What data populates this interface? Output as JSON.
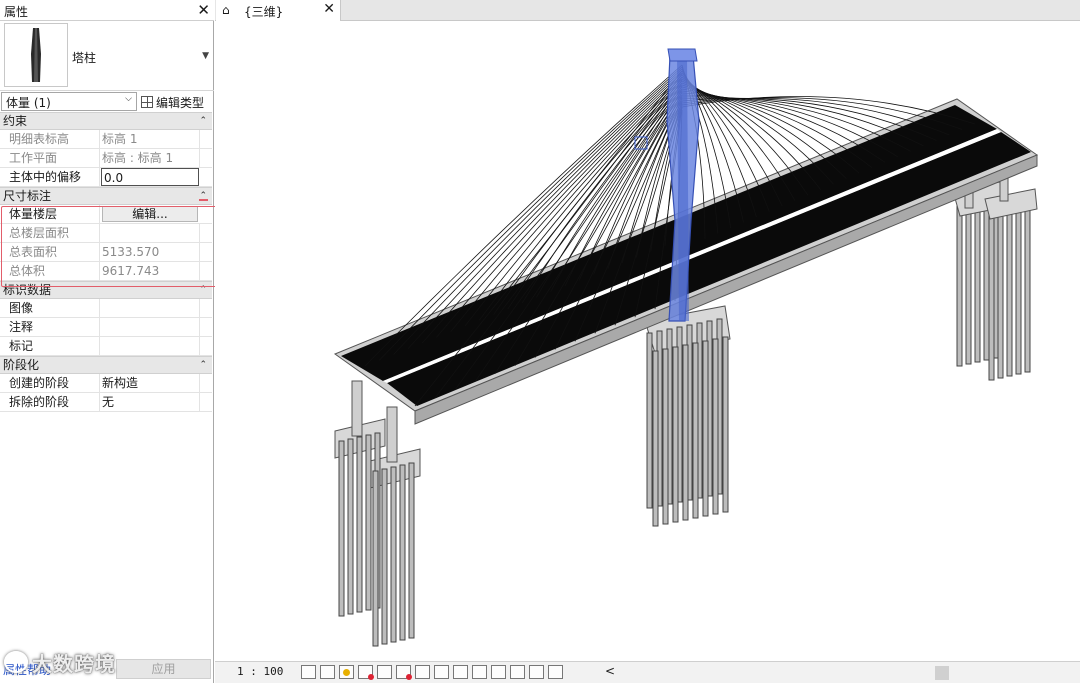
{
  "properties": {
    "title": "属性",
    "type_name": "塔柱",
    "instance_select": "体量 (1)",
    "edit_type_label": "编辑类型",
    "sections": [
      {
        "name": "约束",
        "rows": [
          {
            "key": "明细表标高",
            "value": "标高 1",
            "disabled": true
          },
          {
            "key": "工作平面",
            "value": "标高 : 标高 1",
            "disabled": true
          },
          {
            "key": "主体中的偏移",
            "value": "0.0",
            "disabled": false
          }
        ]
      },
      {
        "name": "尺寸标注",
        "rows": [
          {
            "key": "体量楼层",
            "value": "编辑...",
            "disabled": false
          },
          {
            "key": "总楼层面积",
            "value": "",
            "disabled": true
          },
          {
            "key": "总表面积",
            "value": "5133.570",
            "disabled": true
          },
          {
            "key": "总体积",
            "value": "9617.743",
            "disabled": true
          }
        ]
      },
      {
        "name": "标识数据",
        "rows": [
          {
            "key": "图像",
            "value": "",
            "disabled": false
          },
          {
            "key": "注释",
            "value": "",
            "disabled": false
          },
          {
            "key": "标记",
            "value": "",
            "disabled": false
          }
        ]
      },
      {
        "name": "阶段化",
        "rows": [
          {
            "key": "创建的阶段",
            "value": "新构造",
            "disabled": false
          },
          {
            "key": "拆除的阶段",
            "value": "无",
            "disabled": false
          }
        ]
      }
    ],
    "help_link": "属性帮助",
    "apply_button": "应用"
  },
  "view": {
    "tab_label": "{三维}",
    "scale": "1 : 100"
  },
  "watermark": "大数跨境",
  "colors": {
    "selection_blue": "#5a78d8",
    "deck": "#0a0a0a",
    "concrete": "#c9c9c9",
    "highlight_box": "#e25d6a"
  }
}
